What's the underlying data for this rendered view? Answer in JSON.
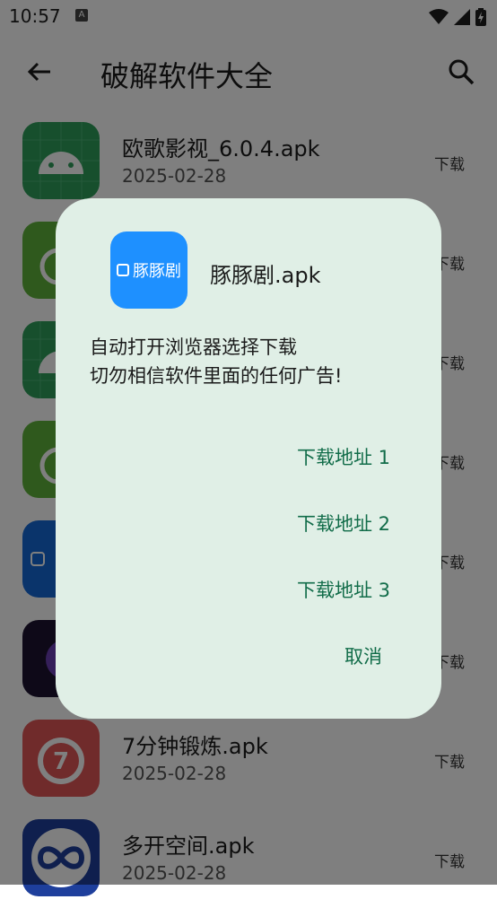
{
  "status": {
    "time": "10:57",
    "note_icon": "A"
  },
  "appbar": {
    "title": "破解软件大全",
    "back_icon": "arrow-back-icon",
    "search_icon": "search-icon"
  },
  "list": {
    "download_label": "下载",
    "items": [
      {
        "name": "欧歌影视_6.0.4.apk",
        "date": "2025-02-28",
        "icon": "android-grid-icon",
        "color": "#2e9e5b"
      },
      {
        "name": "",
        "date": "",
        "icon": "android-icon",
        "color": "#5fb33a"
      },
      {
        "name": "",
        "date": "",
        "icon": "android-grid-icon",
        "color": "#2e9e5b"
      },
      {
        "name": "",
        "date": "",
        "icon": "android-icon",
        "color": "#5fb33a"
      },
      {
        "name": "",
        "date": "",
        "icon": "app-blue-icon",
        "color": "#1469d6"
      },
      {
        "name": "",
        "date": "",
        "icon": "app-purple-icon",
        "color": "#1c1330"
      },
      {
        "name": "7分钟锻炼.apk",
        "date": "2025-02-28",
        "icon": "stopwatch-icon",
        "color": "#e05656"
      },
      {
        "name": "多开空间.apk",
        "date": "2025-02-28",
        "icon": "infinity-icon",
        "color": "#1e3f9c"
      }
    ]
  },
  "dialog": {
    "app_name": "豚豚剧.apk",
    "icon_text": "豚豚剧",
    "icon_color": "#1e90ff",
    "message_line1": "自动打开浏览器选择下载",
    "message_line2": "切勿相信软件里面的任何广告!",
    "download1": "下载地址 1",
    "download2": "下载地址 2",
    "download3": "下载地址 3",
    "cancel": "取消"
  }
}
